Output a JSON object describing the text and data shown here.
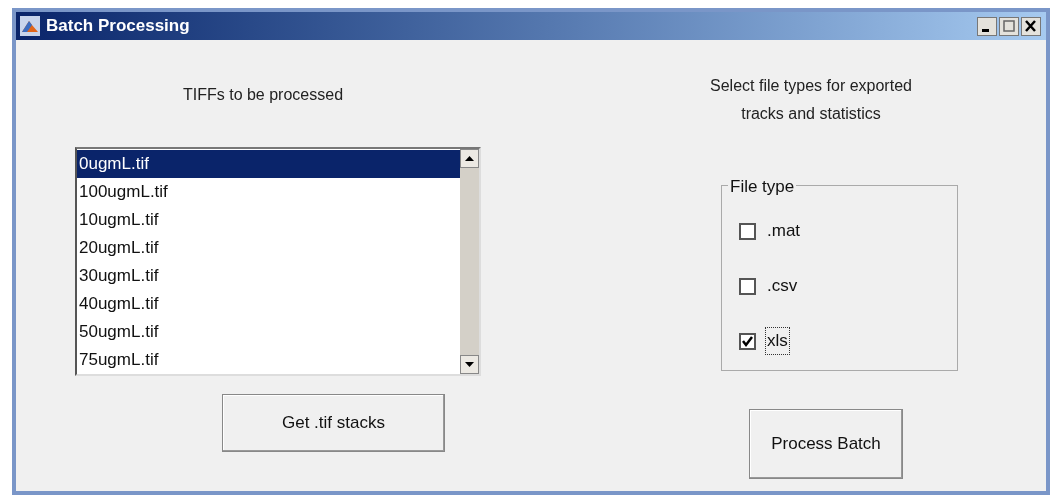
{
  "window": {
    "title": "Batch Processing",
    "controls": [
      {
        "kind": "minimize"
      },
      {
        "kind": "maximize"
      },
      {
        "kind": "close"
      }
    ]
  },
  "list_label": "TIFFs to be processed",
  "files": [
    {
      "name": "0ugmL.tif",
      "selected": true
    },
    {
      "name": "100ugmL.tif",
      "selected": false
    },
    {
      "name": "10ugmL.tif",
      "selected": false
    },
    {
      "name": "20ugmL.tif",
      "selected": false
    },
    {
      "name": "30ugmL.tif",
      "selected": false
    },
    {
      "name": "40ugmL.tif",
      "selected": false
    },
    {
      "name": "50ugmL.tif",
      "selected": false
    },
    {
      "name": "75ugmL.tif",
      "selected": false
    }
  ],
  "get_button": "Get .tif stacks",
  "export_label": [
    "Select file types for exported",
    "tracks and statistics"
  ],
  "file_type_group": {
    "title": "File type",
    "options": [
      {
        "label": ".mat",
        "checked": false,
        "focused": false
      },
      {
        "label": ".csv",
        "checked": false,
        "focused": false
      },
      {
        "label": "xls",
        "checked": true,
        "focused": true
      }
    ]
  },
  "process_button": "Process Batch"
}
